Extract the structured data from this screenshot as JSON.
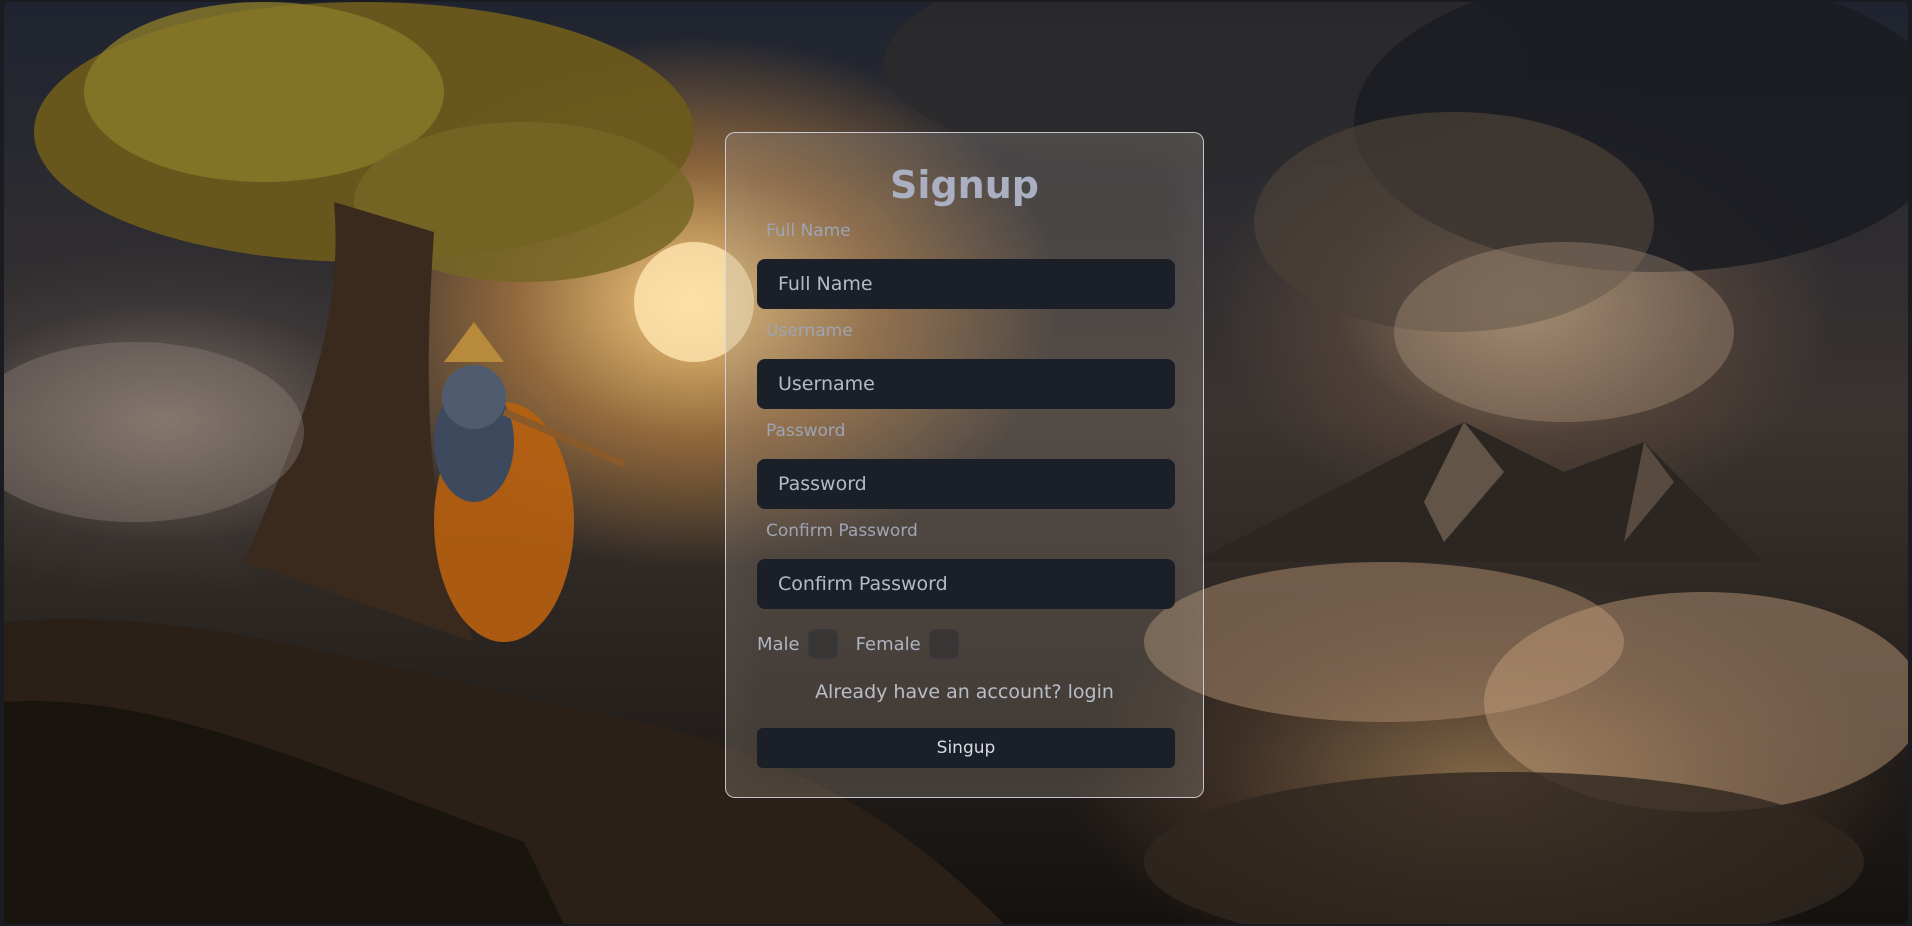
{
  "form": {
    "title": "Signup",
    "full_name": {
      "label": "Full Name",
      "placeholder": "Full Name"
    },
    "username": {
      "label": "Username",
      "placeholder": "Username"
    },
    "password": {
      "label": "Password",
      "placeholder": "Password"
    },
    "confirm_password": {
      "label": "Confirm Password",
      "placeholder": "Confirm Password"
    },
    "gender": {
      "male_label": "Male",
      "female_label": "Female"
    },
    "already_text": "Already have an account?",
    "login_link": "login",
    "submit_label": "Singup"
  },
  "colors": {
    "input_bg": "#1b2028",
    "title": "#aab0c2",
    "label": "#9ea4b4"
  }
}
